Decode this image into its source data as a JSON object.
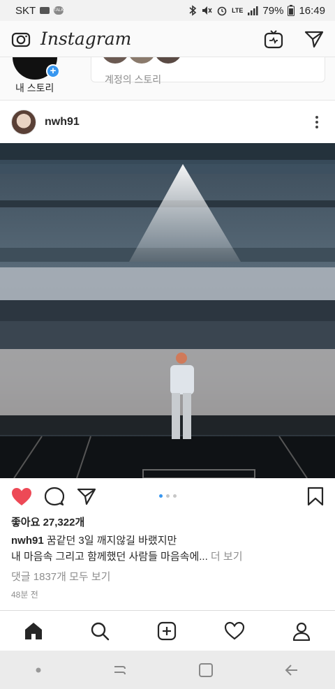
{
  "status": {
    "carrier": "SKT",
    "battery": "79%",
    "time": "16:49",
    "network": "LTE"
  },
  "app": {
    "title": "Instagram"
  },
  "stories": {
    "my_story_label": "내 스토리",
    "followed_label": "계정의 스토리"
  },
  "post": {
    "username": "nwh91",
    "likes": "좋아요 27,322개",
    "caption_user": "nwh91",
    "caption_line1": "꿈같던 3일 깨지않길 바랬지만",
    "caption_line2": "내 마음속 그리고 함께했던 사람들 마음속에...",
    "caption_more": "더 보기",
    "comments": "댓글 1837개 모두 보기",
    "time": "48분 전",
    "carousel": {
      "count": 3,
      "active": 1
    }
  },
  "colors": {
    "like_red": "#ed4956",
    "accent_blue": "#3897f0"
  }
}
